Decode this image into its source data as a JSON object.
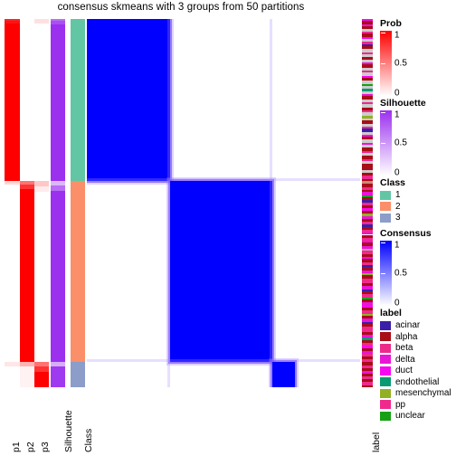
{
  "title": "consensus skmeans with 3 groups from 50 partitions",
  "axis": {
    "bottom_labels": [
      "p1",
      "p2",
      "p3",
      "Silhouette",
      "Class"
    ],
    "right_label": "label"
  },
  "legends": {
    "prob": {
      "title": "Prob",
      "type": "continuous",
      "ticks": [
        "1",
        "0.5",
        "0"
      ],
      "tick_values": [
        1,
        0.5,
        0
      ],
      "color_high": "#ff0000",
      "color_low": "#ffffff"
    },
    "silhouette": {
      "title": "Silhouette",
      "type": "continuous",
      "ticks": [
        "1",
        "0.5",
        "0"
      ],
      "tick_values": [
        1,
        0.5,
        0
      ],
      "color_high": "#9b30ef",
      "color_low": "#ffffff"
    },
    "class": {
      "title": "Class",
      "type": "discrete",
      "items": [
        {
          "label": "1",
          "color": "#62c6a4"
        },
        {
          "label": "2",
          "color": "#fa8f69"
        },
        {
          "label": "3",
          "color": "#8b9dc8"
        }
      ]
    },
    "consensus": {
      "title": "Consensus",
      "type": "continuous",
      "ticks": [
        "1",
        "0.5",
        "0"
      ],
      "tick_values": [
        1,
        0.5,
        0
      ],
      "color_high": "#0000ff",
      "color_low": "#ffffff"
    },
    "label": {
      "title": "label",
      "type": "discrete",
      "items": [
        {
          "label": "acinar",
          "color": "#3b1fa8"
        },
        {
          "label": "alpha",
          "color": "#a80d18"
        },
        {
          "label": "beta",
          "color": "#ed2a8c"
        },
        {
          "label": "delta",
          "color": "#e915d6"
        },
        {
          "label": "duct",
          "color": "#f808f0"
        },
        {
          "label": "endothelial",
          "color": "#089a72"
        },
        {
          "label": "mesenchymal",
          "color": "#92b024"
        },
        {
          "label": "pp",
          "color": "#f02a8c"
        },
        {
          "label": "unclear",
          "color": "#17a015"
        }
      ]
    }
  },
  "chart_data": {
    "type": "heatmap",
    "title": "consensus skmeans with 3 groups from 50 partitions",
    "method": "skmeans",
    "n_groups": 3,
    "n_partitions": 50,
    "n_samples": 100,
    "groups": [
      {
        "class": 1,
        "color": "#62c6a4",
        "start_frac": 0.0,
        "end_frac": 0.441
      },
      {
        "class": 2,
        "color": "#fa8f69",
        "start_frac": 0.441,
        "end_frac": 0.931
      },
      {
        "class": 3,
        "color": "#8b9dc8",
        "start_frac": 0.931,
        "end_frac": 1.0
      }
    ],
    "consensus_blocks": [
      {
        "group": 1,
        "x0": 0.0,
        "x1": 0.305,
        "y0": 0.0,
        "y1": 0.441,
        "value": 1.0
      },
      {
        "group": 2,
        "x0": 0.305,
        "x1": 0.68,
        "y0": 0.441,
        "y1": 0.931,
        "value": 1.0
      },
      {
        "group": 3,
        "x0": 0.68,
        "x1": 0.76,
        "y0": 0.931,
        "y1": 1.0,
        "value": 1.0
      }
    ],
    "annotations": {
      "prob_columns": [
        "p1",
        "p2",
        "p3"
      ],
      "silhouette_column": "Silhouette",
      "class_column": "Class",
      "label_column": "label"
    },
    "p1_segments": [
      {
        "y0": 0.0,
        "y1": 0.006,
        "v": 0.86
      },
      {
        "y0": 0.006,
        "y1": 0.012,
        "v": 0.93
      },
      {
        "y0": 0.012,
        "y1": 0.441,
        "v": 1.0
      },
      {
        "y0": 0.441,
        "y1": 0.449,
        "v": 0.16
      },
      {
        "y0": 0.449,
        "y1": 0.931,
        "v": 0.0
      },
      {
        "y0": 0.931,
        "y1": 0.944,
        "v": 0.1
      },
      {
        "y0": 0.944,
        "y1": 1.0,
        "v": 0.0
      }
    ],
    "p2_segments": [
      {
        "y0": 0.0,
        "y1": 0.441,
        "v": 0.0
      },
      {
        "y0": 0.441,
        "y1": 0.449,
        "v": 0.55
      },
      {
        "y0": 0.449,
        "y1": 0.461,
        "v": 0.8
      },
      {
        "y0": 0.461,
        "y1": 0.931,
        "v": 1.0
      },
      {
        "y0": 0.931,
        "y1": 0.944,
        "v": 0.3
      },
      {
        "y0": 0.944,
        "y1": 1.0,
        "v": 0.05
      }
    ],
    "p3_segments": [
      {
        "y0": 0.0,
        "y1": 0.012,
        "v": 0.12
      },
      {
        "y0": 0.012,
        "y1": 0.441,
        "v": 0.0
      },
      {
        "y0": 0.441,
        "y1": 0.455,
        "v": 0.22
      },
      {
        "y0": 0.455,
        "y1": 0.47,
        "v": 0.08
      },
      {
        "y0": 0.47,
        "y1": 0.931,
        "v": 0.0
      },
      {
        "y0": 0.931,
        "y1": 0.944,
        "v": 0.55
      },
      {
        "y0": 0.944,
        "y1": 0.958,
        "v": 0.8
      },
      {
        "y0": 0.958,
        "y1": 1.0,
        "v": 1.0
      }
    ],
    "silhouette_segments": [
      {
        "y0": 0.0,
        "y1": 0.006,
        "v": 0.7
      },
      {
        "y0": 0.006,
        "y1": 0.015,
        "v": 0.85
      },
      {
        "y0": 0.015,
        "y1": 0.441,
        "v": 1.0
      },
      {
        "y0": 0.441,
        "y1": 0.452,
        "v": 0.35
      },
      {
        "y0": 0.452,
        "y1": 0.466,
        "v": 0.7
      },
      {
        "y0": 0.466,
        "y1": 0.931,
        "v": 1.0
      },
      {
        "y0": 0.931,
        "y1": 0.944,
        "v": 0.4
      },
      {
        "y0": 0.944,
        "y1": 1.0,
        "v": 0.95
      }
    ],
    "label_strip": [
      {
        "y0": 0.0,
        "y1": 0.006,
        "c": "#f808f0"
      },
      {
        "y0": 0.006,
        "y1": 0.014,
        "c": "#a80d18"
      },
      {
        "y0": 0.014,
        "y1": 0.02,
        "c": "#e915d6"
      },
      {
        "y0": 0.02,
        "y1": 0.026,
        "c": "#a80d18"
      },
      {
        "y0": 0.026,
        "y1": 0.034,
        "c": "#cccccc"
      },
      {
        "y0": 0.034,
        "y1": 0.04,
        "c": "#ed2a8c"
      },
      {
        "y0": 0.04,
        "y1": 0.048,
        "c": "#a80d18"
      },
      {
        "y0": 0.048,
        "y1": 0.054,
        "c": "#f808f0"
      },
      {
        "y0": 0.054,
        "y1": 0.062,
        "c": "#cccccc"
      },
      {
        "y0": 0.062,
        "y1": 0.068,
        "c": "#ed2a8c"
      },
      {
        "y0": 0.068,
        "y1": 0.074,
        "c": "#3b1fa8"
      },
      {
        "y0": 0.074,
        "y1": 0.082,
        "c": "#a80d18"
      },
      {
        "y0": 0.082,
        "y1": 0.09,
        "c": "#cccccc"
      },
      {
        "y0": 0.09,
        "y1": 0.096,
        "c": "#f02a8c"
      },
      {
        "y0": 0.096,
        "y1": 0.104,
        "c": "#cccccc"
      },
      {
        "y0": 0.104,
        "y1": 0.11,
        "c": "#a80d18"
      },
      {
        "y0": 0.11,
        "y1": 0.118,
        "c": "#cccccc"
      },
      {
        "y0": 0.118,
        "y1": 0.124,
        "c": "#e915d6"
      },
      {
        "y0": 0.124,
        "y1": 0.132,
        "c": "#a80d18"
      },
      {
        "y0": 0.132,
        "y1": 0.14,
        "c": "#cccccc"
      },
      {
        "y0": 0.14,
        "y1": 0.146,
        "c": "#ed2a8c"
      },
      {
        "y0": 0.146,
        "y1": 0.154,
        "c": "#cccccc"
      },
      {
        "y0": 0.154,
        "y1": 0.16,
        "c": "#f808f0"
      },
      {
        "y0": 0.16,
        "y1": 0.168,
        "c": "#a80d18"
      },
      {
        "y0": 0.168,
        "y1": 0.176,
        "c": "#cccccc"
      },
      {
        "y0": 0.176,
        "y1": 0.182,
        "c": "#17a015"
      },
      {
        "y0": 0.182,
        "y1": 0.19,
        "c": "#cccccc"
      },
      {
        "y0": 0.19,
        "y1": 0.196,
        "c": "#089a72"
      },
      {
        "y0": 0.196,
        "y1": 0.204,
        "c": "#cccccc"
      },
      {
        "y0": 0.204,
        "y1": 0.21,
        "c": "#e915d6"
      },
      {
        "y0": 0.21,
        "y1": 0.218,
        "c": "#a80d18"
      },
      {
        "y0": 0.218,
        "y1": 0.226,
        "c": "#cccccc"
      },
      {
        "y0": 0.226,
        "y1": 0.232,
        "c": "#ed2a8c"
      },
      {
        "y0": 0.232,
        "y1": 0.24,
        "c": "#cccccc"
      },
      {
        "y0": 0.24,
        "y1": 0.248,
        "c": "#a80d18"
      },
      {
        "y0": 0.248,
        "y1": 0.254,
        "c": "#f02a8c"
      },
      {
        "y0": 0.254,
        "y1": 0.262,
        "c": "#cccccc"
      },
      {
        "y0": 0.262,
        "y1": 0.27,
        "c": "#92b024"
      },
      {
        "y0": 0.27,
        "y1": 0.276,
        "c": "#cccccc"
      },
      {
        "y0": 0.276,
        "y1": 0.284,
        "c": "#a80d18"
      },
      {
        "y0": 0.284,
        "y1": 0.292,
        "c": "#cccccc"
      },
      {
        "y0": 0.292,
        "y1": 0.298,
        "c": "#ed2a8c"
      },
      {
        "y0": 0.298,
        "y1": 0.306,
        "c": "#3b1fa8"
      },
      {
        "y0": 0.306,
        "y1": 0.314,
        "c": "#cccccc"
      },
      {
        "y0": 0.314,
        "y1": 0.32,
        "c": "#f808f0"
      },
      {
        "y0": 0.32,
        "y1": 0.328,
        "c": "#a80d18"
      },
      {
        "y0": 0.328,
        "y1": 0.336,
        "c": "#cccccc"
      },
      {
        "y0": 0.336,
        "y1": 0.342,
        "c": "#e915d6"
      },
      {
        "y0": 0.342,
        "y1": 0.35,
        "c": "#cccccc"
      },
      {
        "y0": 0.35,
        "y1": 0.358,
        "c": "#a80d18"
      },
      {
        "y0": 0.358,
        "y1": 0.364,
        "c": "#ed2a8c"
      },
      {
        "y0": 0.364,
        "y1": 0.372,
        "c": "#cccccc"
      },
      {
        "y0": 0.372,
        "y1": 0.38,
        "c": "#a80d18"
      },
      {
        "y0": 0.38,
        "y1": 0.386,
        "c": "#f02a8c"
      },
      {
        "y0": 0.386,
        "y1": 0.394,
        "c": "#cccccc"
      },
      {
        "y0": 0.394,
        "y1": 0.402,
        "c": "#a80d18"
      },
      {
        "y0": 0.402,
        "y1": 0.41,
        "c": "#a80d18"
      },
      {
        "y0": 0.41,
        "y1": 0.418,
        "c": "#cccccc"
      },
      {
        "y0": 0.418,
        "y1": 0.426,
        "c": "#a80d18"
      },
      {
        "y0": 0.426,
        "y1": 0.434,
        "c": "#ed2a8c"
      },
      {
        "y0": 0.434,
        "y1": 0.441,
        "c": "#a80d18"
      },
      {
        "y0": 0.441,
        "y1": 0.448,
        "c": "#cc8877"
      },
      {
        "y0": 0.448,
        "y1": 0.456,
        "c": "#a80d18"
      },
      {
        "y0": 0.456,
        "y1": 0.464,
        "c": "#ed2a8c"
      },
      {
        "y0": 0.464,
        "y1": 0.47,
        "c": "#a80d18"
      },
      {
        "y0": 0.47,
        "y1": 0.478,
        "c": "#e915d6"
      },
      {
        "y0": 0.478,
        "y1": 0.484,
        "c": "#17a015"
      },
      {
        "y0": 0.484,
        "y1": 0.492,
        "c": "#a80d18"
      },
      {
        "y0": 0.492,
        "y1": 0.498,
        "c": "#3b1fa8"
      },
      {
        "y0": 0.498,
        "y1": 0.506,
        "c": "#ed2a8c"
      },
      {
        "y0": 0.506,
        "y1": 0.514,
        "c": "#a80d18"
      },
      {
        "y0": 0.514,
        "y1": 0.52,
        "c": "#f808f0"
      },
      {
        "y0": 0.52,
        "y1": 0.528,
        "c": "#a80d18"
      },
      {
        "y0": 0.528,
        "y1": 0.536,
        "c": "#92b024"
      },
      {
        "y0": 0.536,
        "y1": 0.542,
        "c": "#e915d6"
      },
      {
        "y0": 0.542,
        "y1": 0.55,
        "c": "#a80d18"
      },
      {
        "y0": 0.55,
        "y1": 0.558,
        "c": "#ed2a8c"
      },
      {
        "y0": 0.558,
        "y1": 0.564,
        "c": "#3b1fa8"
      },
      {
        "y0": 0.564,
        "y1": 0.572,
        "c": "#a80d18"
      },
      {
        "y0": 0.572,
        "y1": 0.58,
        "c": "#f02a8c"
      },
      {
        "y0": 0.58,
        "y1": 0.586,
        "c": "#e915d6"
      },
      {
        "y0": 0.586,
        "y1": 0.594,
        "c": "#a80d18"
      },
      {
        "y0": 0.594,
        "y1": 0.602,
        "c": "#ed2a8c"
      },
      {
        "y0": 0.602,
        "y1": 0.608,
        "c": "#f808f0"
      },
      {
        "y0": 0.608,
        "y1": 0.616,
        "c": "#a80d18"
      },
      {
        "y0": 0.616,
        "y1": 0.624,
        "c": "#e915d6"
      },
      {
        "y0": 0.624,
        "y1": 0.63,
        "c": "#cc99aa"
      },
      {
        "y0": 0.63,
        "y1": 0.638,
        "c": "#ed2a8c"
      },
      {
        "y0": 0.638,
        "y1": 0.646,
        "c": "#a80d18"
      },
      {
        "y0": 0.646,
        "y1": 0.652,
        "c": "#f808f0"
      },
      {
        "y0": 0.652,
        "y1": 0.66,
        "c": "#a80d18"
      },
      {
        "y0": 0.66,
        "y1": 0.668,
        "c": "#ed2a8c"
      },
      {
        "y0": 0.668,
        "y1": 0.674,
        "c": "#3b1fa8"
      },
      {
        "y0": 0.674,
        "y1": 0.682,
        "c": "#a80d18"
      },
      {
        "y0": 0.682,
        "y1": 0.69,
        "c": "#e915d6"
      },
      {
        "y0": 0.69,
        "y1": 0.696,
        "c": "#92b024"
      },
      {
        "y0": 0.696,
        "y1": 0.704,
        "c": "#a80d18"
      },
      {
        "y0": 0.704,
        "y1": 0.712,
        "c": "#ed2a8c"
      },
      {
        "y0": 0.712,
        "y1": 0.718,
        "c": "#f02a8c"
      },
      {
        "y0": 0.718,
        "y1": 0.726,
        "c": "#a80d18"
      },
      {
        "y0": 0.726,
        "y1": 0.734,
        "c": "#e915d6"
      },
      {
        "y0": 0.734,
        "y1": 0.74,
        "c": "#3b1fa8"
      },
      {
        "y0": 0.74,
        "y1": 0.748,
        "c": "#a80d18"
      },
      {
        "y0": 0.748,
        "y1": 0.756,
        "c": "#ed2a8c"
      },
      {
        "y0": 0.756,
        "y1": 0.762,
        "c": "#17a015"
      },
      {
        "y0": 0.762,
        "y1": 0.77,
        "c": "#a80d18"
      },
      {
        "y0": 0.77,
        "y1": 0.778,
        "c": "#e915d6"
      },
      {
        "y0": 0.778,
        "y1": 0.784,
        "c": "#f808f0"
      },
      {
        "y0": 0.784,
        "y1": 0.792,
        "c": "#a80d18"
      },
      {
        "y0": 0.792,
        "y1": 0.8,
        "c": "#ed2a8c"
      },
      {
        "y0": 0.8,
        "y1": 0.806,
        "c": "#92b024"
      },
      {
        "y0": 0.806,
        "y1": 0.814,
        "c": "#a80d18"
      },
      {
        "y0": 0.814,
        "y1": 0.822,
        "c": "#e915d6"
      },
      {
        "y0": 0.822,
        "y1": 0.828,
        "c": "#3b1fa8"
      },
      {
        "y0": 0.828,
        "y1": 0.836,
        "c": "#a80d18"
      },
      {
        "y0": 0.836,
        "y1": 0.844,
        "c": "#ed2a8c"
      },
      {
        "y0": 0.844,
        "y1": 0.85,
        "c": "#f02a8c"
      },
      {
        "y0": 0.85,
        "y1": 0.858,
        "c": "#a80d18"
      },
      {
        "y0": 0.858,
        "y1": 0.866,
        "c": "#e915d6"
      },
      {
        "y0": 0.866,
        "y1": 0.872,
        "c": "#089a72"
      },
      {
        "y0": 0.872,
        "y1": 0.88,
        "c": "#a80d18"
      },
      {
        "y0": 0.88,
        "y1": 0.888,
        "c": "#ed2a8c"
      },
      {
        "y0": 0.888,
        "y1": 0.894,
        "c": "#f808f0"
      },
      {
        "y0": 0.894,
        "y1": 0.902,
        "c": "#a80d18"
      },
      {
        "y0": 0.902,
        "y1": 0.91,
        "c": "#e915d6"
      },
      {
        "y0": 0.91,
        "y1": 0.916,
        "c": "#ed2a8c"
      },
      {
        "y0": 0.916,
        "y1": 0.924,
        "c": "#a80d18"
      },
      {
        "y0": 0.924,
        "y1": 0.931,
        "c": "#f02a8c"
      },
      {
        "y0": 0.931,
        "y1": 0.94,
        "c": "#a80d18"
      },
      {
        "y0": 0.94,
        "y1": 0.948,
        "c": "#ed2a8c"
      },
      {
        "y0": 0.948,
        "y1": 0.956,
        "c": "#a80d18"
      },
      {
        "y0": 0.956,
        "y1": 0.962,
        "c": "#e915d6"
      },
      {
        "y0": 0.962,
        "y1": 0.97,
        "c": "#a80d18"
      },
      {
        "y0": 0.97,
        "y1": 0.978,
        "c": "#ed2a8c"
      },
      {
        "y0": 0.978,
        "y1": 0.986,
        "c": "#a80d18"
      },
      {
        "y0": 0.986,
        "y1": 0.994,
        "c": "#f02a8c"
      },
      {
        "y0": 0.994,
        "y1": 1.0,
        "c": "#a80d18"
      }
    ]
  }
}
